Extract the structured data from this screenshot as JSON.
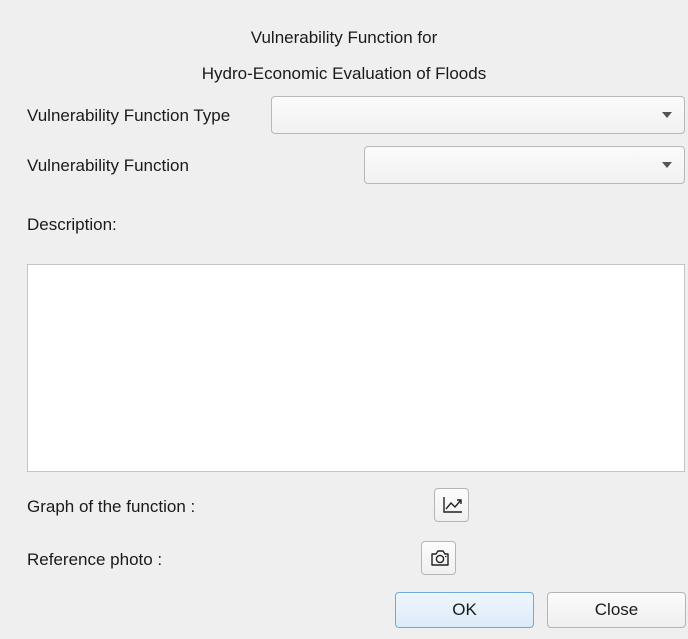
{
  "dialog": {
    "title_line1": "Vulnerability Function for",
    "title_line2": "Hydro-Economic Evaluation of Floods"
  },
  "form": {
    "function_type_label": "Vulnerability Function Type",
    "function_type_value": "",
    "function_label": "Vulnerability Function",
    "function_value": "",
    "description_label": "Description:",
    "description_text": "",
    "graph_label": "Graph of the function :",
    "photo_label": "Reference photo   :"
  },
  "icons": {
    "graph_button_icon": "line-chart-icon",
    "photo_button_icon": "camera-icon",
    "dropdown_icon": "chevron-down-icon"
  },
  "buttons": {
    "ok_label": "OK",
    "close_label": "Close"
  },
  "colors": {
    "background": "#efefef",
    "ok_border": "#6fa8dc",
    "ok_fill": "#dcebf9"
  }
}
